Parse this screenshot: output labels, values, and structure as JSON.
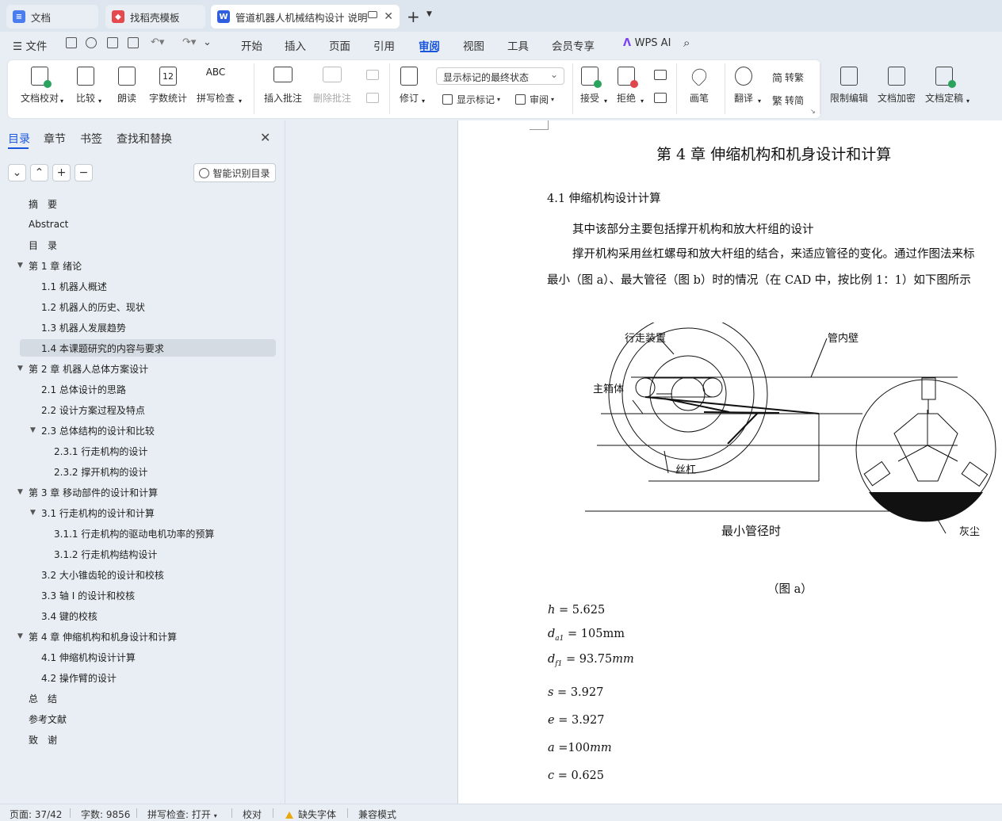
{
  "tabs": [
    {
      "label": "文档"
    },
    {
      "label": "找稻壳模板"
    },
    {
      "label": "管道机器人机械结构设计 说明"
    }
  ],
  "menu": {
    "file": "文件",
    "items": [
      "开始",
      "插入",
      "页面",
      "引用",
      "审阅",
      "视图",
      "工具",
      "会员专享",
      "WPS AI"
    ],
    "active": "审阅"
  },
  "ribbon": {
    "proofread": "文档校对",
    "compare": "比较",
    "read_aloud": "朗读",
    "word_count": "字数统计",
    "spell_check": "拼写检查",
    "insert_comment": "插入批注",
    "delete_comment": "删除批注",
    "track_changes": "修订",
    "markup_state": "显示标记的最终状态",
    "show_markup": "显示标记",
    "review": "审阅",
    "accept": "接受",
    "reject": "拒绝",
    "pen": "画笔",
    "translate": "翻译",
    "to_traditional": "转繁",
    "to_simplified": "转简",
    "restrict_edit": "限制编辑",
    "encrypt": "文档加密",
    "finalize": "文档定稿",
    "word_count_icon_text": "12",
    "spell_icon_text": "ABC"
  },
  "nav": {
    "tabs": [
      "目录",
      "章节",
      "书签",
      "查找和替换"
    ],
    "smart_toc": "智能识别目录",
    "toc": [
      {
        "label": "摘　要",
        "level": 0,
        "arrow": ""
      },
      {
        "label": "Abstract",
        "level": 0,
        "arrow": ""
      },
      {
        "label": "目　录",
        "level": 0,
        "arrow": ""
      },
      {
        "label": "第 1 章  绪论",
        "level": 0,
        "arrow": "▼"
      },
      {
        "label": "1.1  机器人概述",
        "level": 1,
        "arrow": ""
      },
      {
        "label": "1.2  机器人的历史、现状",
        "level": 1,
        "arrow": ""
      },
      {
        "label": "1.3 机器人发展趋势",
        "level": 1,
        "arrow": ""
      },
      {
        "label": "1.4  本课题研究的内容与要求",
        "level": 1,
        "arrow": "",
        "selected": true
      },
      {
        "label": "第 2 章  机器人总体方案设计",
        "level": 0,
        "arrow": "▼"
      },
      {
        "label": "2.1 总体设计的思路",
        "level": 1,
        "arrow": ""
      },
      {
        "label": "2.2  设计方案过程及特点",
        "level": 1,
        "arrow": ""
      },
      {
        "label": "2.3  总体结构的设计和比较",
        "level": 1,
        "arrow": "▼"
      },
      {
        "label": "2.3.1  行走机构的设计",
        "level": 2,
        "arrow": ""
      },
      {
        "label": "2.3.2  撑开机构的设计",
        "level": 2,
        "arrow": ""
      },
      {
        "label": "第 3 章  移动部件的设计和计算",
        "level": 0,
        "arrow": "▼"
      },
      {
        "label": "3.1  行走机构的设计和计算",
        "level": 1,
        "arrow": "▼"
      },
      {
        "label": "3.1.1  行走机构的驱动电机功率的预算",
        "level": 2,
        "arrow": ""
      },
      {
        "label": "3.1.2  行走机构结构设计",
        "level": 2,
        "arrow": ""
      },
      {
        "label": "3.2 大小锥齿轮的设计和校核",
        "level": 1,
        "arrow": ""
      },
      {
        "label": "3.3  轴 I 的设计和校核",
        "level": 1,
        "arrow": ""
      },
      {
        "label": "3.4  键的校核",
        "level": 1,
        "arrow": ""
      },
      {
        "label": "第 4 章  伸缩机构和机身设计和计算",
        "level": 0,
        "arrow": "▼"
      },
      {
        "label": "4.1  伸缩机构设计计算",
        "level": 1,
        "arrow": ""
      },
      {
        "label": "4.2  操作臂的设计",
        "level": 1,
        "arrow": ""
      },
      {
        "label": "总　结",
        "level": 0,
        "arrow": ""
      },
      {
        "label": "参考文献",
        "level": 0,
        "arrow": ""
      },
      {
        "label": "致　谢",
        "level": 0,
        "arrow": ""
      }
    ]
  },
  "doc": {
    "chapter_title": "第 4 章  伸缩机构和机身设计和计算",
    "section_title": "4.1  伸缩机构设计计算",
    "para1": "其中该部分主要包括撑开机构和放大杆组的设计",
    "para2": "撑开机构采用丝杠螺母和放大杆组的结合，来适应管径的变化。通过作图法来标",
    "para3": "最小（图 a）、最大管径（图 b）时的情况（在 CAD 中，按比例 1：1）如下图所示",
    "figure": {
      "label_walk": "行走装置",
      "label_wall": "管内壁",
      "label_body": "主箱体",
      "label_screw": "丝杠",
      "label_min": "最小管径时",
      "label_dust": "灰尘"
    },
    "caption": "（图 a）",
    "formulas": {
      "h": "5.625",
      "da1": "105mm",
      "df1": "93.75",
      "df1_unit": "mm",
      "s": "3.927",
      "e": "3.927",
      "a": "100",
      "a_unit": "mm",
      "c": "0.625"
    }
  },
  "status": {
    "page": "页面: 37/42",
    "words": "字数: 9856",
    "spell": "拼写检查: 打开",
    "proof": "校对",
    "missing_font": "缺失字体",
    "compat": "兼容模式"
  }
}
